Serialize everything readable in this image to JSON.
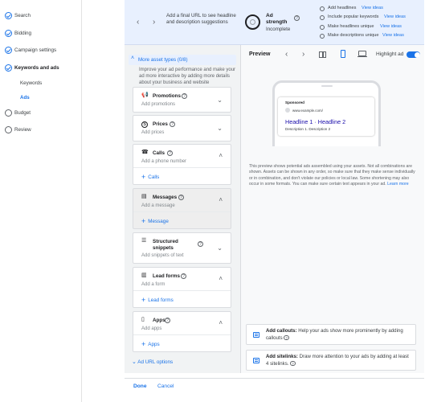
{
  "nav": {
    "items": [
      {
        "label": "Search",
        "state": "done"
      },
      {
        "label": "Bidding",
        "state": "done"
      },
      {
        "label": "Campaign settings",
        "state": "done"
      },
      {
        "label": "Keywords and ads",
        "state": "current"
      },
      {
        "label": "Budget",
        "state": "todo"
      },
      {
        "label": "Review",
        "state": "todo"
      }
    ],
    "sub_items": [
      {
        "label": "Keywords",
        "active": false
      },
      {
        "label": "Ads",
        "active": true
      }
    ]
  },
  "banner": {
    "hint": "Add a final URL to see headline and description suggestions",
    "strength_label": "Ad strength",
    "strength_value": "Incomplete",
    "recommendations": [
      {
        "label": "Add headlines",
        "link": "View ideas"
      },
      {
        "label": "Include popular keywords",
        "link": "View ideas"
      },
      {
        "label": "Make headlines unique",
        "link": "View ideas"
      },
      {
        "label": "Make descriptions unique",
        "link": "View ideas"
      }
    ]
  },
  "editor": {
    "asset_types_label": "More asset types (0/8)",
    "asset_types_desc": "Improve your ad performance and make your ad more interactive by adding more details about your business and website",
    "cards": [
      {
        "title": "Promotions",
        "sub": "Add promotions",
        "icon": "megaphone-icon",
        "glyph": "📢"
      },
      {
        "title": "Prices",
        "sub": "Add prices",
        "icon": "price-icon",
        "glyph": "$"
      },
      {
        "title": "Calls",
        "sub": "Add a phone number",
        "icon": "phone-icon",
        "glyph": "☎",
        "action": "Calls"
      },
      {
        "title": "Messages",
        "sub": "Add a message",
        "icon": "message-icon",
        "glyph": "▤",
        "action": "Message"
      },
      {
        "title": "Structured snippets",
        "sub": "Add snippets of text",
        "icon": "snippets-icon",
        "glyph": "☰"
      },
      {
        "title": "Lead forms",
        "sub": "Add a form",
        "icon": "lead-form-icon",
        "glyph": "▥",
        "action": "Lead forms"
      },
      {
        "title": "Apps",
        "sub": "Add apps",
        "icon": "apps-icon",
        "glyph": "▯",
        "action": "Apps"
      }
    ],
    "url_options": "Ad URL options"
  },
  "preview": {
    "title": "Preview",
    "highlight_label": "Highlight ad",
    "ad": {
      "sponsored": "Sponsored",
      "url": "www.example.com/",
      "headline": "Headline 1 · Headline 2",
      "description": "Description 1. Description 2"
    },
    "note": "This preview shows potential ads assembled using your assets. Not all combinations are shown. Assets can be shown in any order, so make sure that they make sense individually or in combination, and don't violate our policies or local law. Some shortening may also occur in some formats. You can make sure certain text appears in your ad.",
    "note_link": "Learn more",
    "tips": [
      {
        "bold": "Add callouts:",
        "text": " Help your ads show more prominently by adding callouts"
      },
      {
        "bold": "Add sitelinks:",
        "text": " Draw more attention to your ads by adding at least 4 sitelinks."
      }
    ]
  },
  "footer": {
    "done": "Done",
    "cancel": "Cancel"
  },
  "colors": {
    "accent": "#1a73e8",
    "banner_bg": "#e8f0fe",
    "panel_bg": "#f1f3f4"
  }
}
